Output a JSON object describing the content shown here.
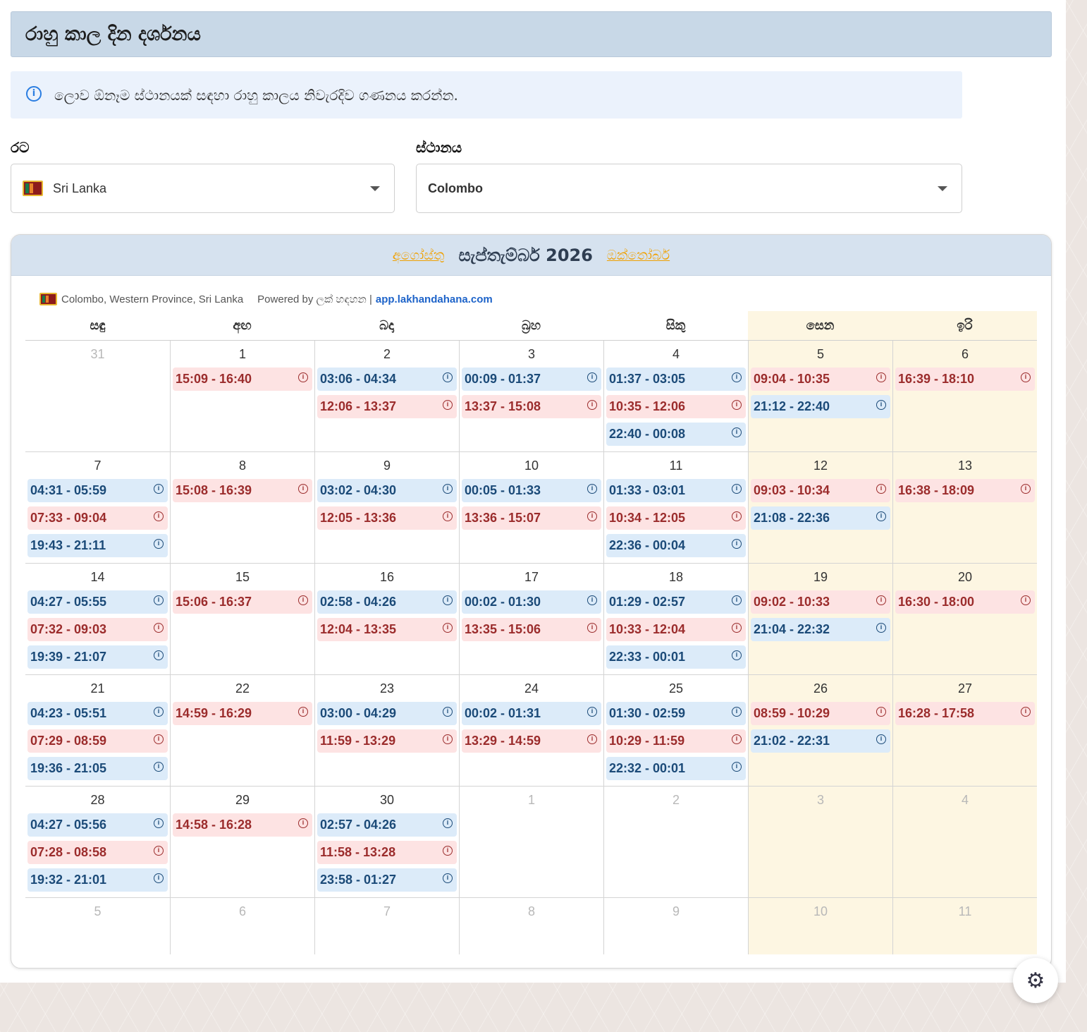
{
  "header": {
    "title": "රාහු කාල දින දර්ශනය"
  },
  "info": {
    "text": "ලොව ඕනෑම ස්ථානයක් සඳහා රාහු කාලය නිවැරදිව ගණනය කරන්න."
  },
  "form": {
    "country_label": "රට",
    "country_value": "Sri Lanka",
    "location_label": "ස්ථානය",
    "location_value": "Colombo"
  },
  "calendar": {
    "prev_month": "අගෝස්තු",
    "current_month": "සැප්තැම්බර් 2026",
    "next_month": "ඔක්තෝබර්",
    "location_line": "Colombo, Western Province, Sri Lanka",
    "powered_by": "Powered by ලක් හඳහන |",
    "site": "app.lakhandahana.com",
    "weekdays": [
      "සඳු",
      "අඟ",
      "බදා",
      "බ්‍රහ",
      "සිකු",
      "සෙන",
      "ඉරි"
    ],
    "weekend_color": "#fdf6e2",
    "red_color": "#9b2c2c",
    "blue_color": "#1b4a78",
    "weeks": [
      [
        {
          "day": "31",
          "muted": true,
          "slots": []
        },
        {
          "day": "1",
          "slots": [
            {
              "t": "15:09 - 16:40",
              "c": "red"
            }
          ]
        },
        {
          "day": "2",
          "slots": [
            {
              "t": "03:06 - 04:34",
              "c": "blue"
            },
            {
              "t": "12:06 - 13:37",
              "c": "red"
            }
          ]
        },
        {
          "day": "3",
          "slots": [
            {
              "t": "00:09 - 01:37",
              "c": "blue"
            },
            {
              "t": "13:37 - 15:08",
              "c": "red"
            }
          ]
        },
        {
          "day": "4",
          "slots": [
            {
              "t": "01:37 - 03:05",
              "c": "blue"
            },
            {
              "t": "10:35 - 12:06",
              "c": "red"
            },
            {
              "t": "22:40 - 00:08",
              "c": "blue"
            }
          ]
        },
        {
          "day": "5",
          "slots": [
            {
              "t": "09:04 - 10:35",
              "c": "red"
            },
            {
              "t": "21:12 - 22:40",
              "c": "blue"
            }
          ]
        },
        {
          "day": "6",
          "slots": [
            {
              "t": "16:39 - 18:10",
              "c": "red"
            }
          ]
        }
      ],
      [
        {
          "day": "7",
          "slots": [
            {
              "t": "04:31 - 05:59",
              "c": "blue"
            },
            {
              "t": "07:33 - 09:04",
              "c": "red"
            },
            {
              "t": "19:43 - 21:11",
              "c": "blue"
            }
          ]
        },
        {
          "day": "8",
          "slots": [
            {
              "t": "15:08 - 16:39",
              "c": "red"
            }
          ]
        },
        {
          "day": "9",
          "slots": [
            {
              "t": "03:02 - 04:30",
              "c": "blue"
            },
            {
              "t": "12:05 - 13:36",
              "c": "red"
            }
          ]
        },
        {
          "day": "10",
          "slots": [
            {
              "t": "00:05 - 01:33",
              "c": "blue"
            },
            {
              "t": "13:36 - 15:07",
              "c": "red"
            }
          ]
        },
        {
          "day": "11",
          "slots": [
            {
              "t": "01:33 - 03:01",
              "c": "blue"
            },
            {
              "t": "10:34 - 12:05",
              "c": "red"
            },
            {
              "t": "22:36 - 00:04",
              "c": "blue"
            }
          ]
        },
        {
          "day": "12",
          "slots": [
            {
              "t": "09:03 - 10:34",
              "c": "red"
            },
            {
              "t": "21:08 - 22:36",
              "c": "blue"
            }
          ]
        },
        {
          "day": "13",
          "slots": [
            {
              "t": "16:38 - 18:09",
              "c": "red"
            }
          ]
        }
      ],
      [
        {
          "day": "14",
          "slots": [
            {
              "t": "04:27 - 05:55",
              "c": "blue"
            },
            {
              "t": "07:32 - 09:03",
              "c": "red"
            },
            {
              "t": "19:39 - 21:07",
              "c": "blue"
            }
          ]
        },
        {
          "day": "15",
          "slots": [
            {
              "t": "15:06 - 16:37",
              "c": "red"
            }
          ]
        },
        {
          "day": "16",
          "slots": [
            {
              "t": "02:58 - 04:26",
              "c": "blue"
            },
            {
              "t": "12:04 - 13:35",
              "c": "red"
            }
          ]
        },
        {
          "day": "17",
          "slots": [
            {
              "t": "00:02 - 01:30",
              "c": "blue"
            },
            {
              "t": "13:35 - 15:06",
              "c": "red"
            }
          ]
        },
        {
          "day": "18",
          "slots": [
            {
              "t": "01:29 - 02:57",
              "c": "blue"
            },
            {
              "t": "10:33 - 12:04",
              "c": "red"
            },
            {
              "t": "22:33 - 00:01",
              "c": "blue"
            }
          ]
        },
        {
          "day": "19",
          "slots": [
            {
              "t": "09:02 - 10:33",
              "c": "red"
            },
            {
              "t": "21:04 - 22:32",
              "c": "blue"
            }
          ]
        },
        {
          "day": "20",
          "slots": [
            {
              "t": "16:30 - 18:00",
              "c": "red"
            }
          ]
        }
      ],
      [
        {
          "day": "21",
          "slots": [
            {
              "t": "04:23 - 05:51",
              "c": "blue"
            },
            {
              "t": "07:29 - 08:59",
              "c": "red"
            },
            {
              "t": "19:36 - 21:05",
              "c": "blue"
            }
          ]
        },
        {
          "day": "22",
          "slots": [
            {
              "t": "14:59 - 16:29",
              "c": "red"
            }
          ]
        },
        {
          "day": "23",
          "slots": [
            {
              "t": "03:00 - 04:29",
              "c": "blue"
            },
            {
              "t": "11:59 - 13:29",
              "c": "red"
            }
          ]
        },
        {
          "day": "24",
          "slots": [
            {
              "t": "00:02 - 01:31",
              "c": "blue"
            },
            {
              "t": "13:29 - 14:59",
              "c": "red"
            }
          ]
        },
        {
          "day": "25",
          "slots": [
            {
              "t": "01:30 - 02:59",
              "c": "blue"
            },
            {
              "t": "10:29 - 11:59",
              "c": "red"
            },
            {
              "t": "22:32 - 00:01",
              "c": "blue"
            }
          ]
        },
        {
          "day": "26",
          "slots": [
            {
              "t": "08:59 - 10:29",
              "c": "red"
            },
            {
              "t": "21:02 - 22:31",
              "c": "blue"
            }
          ]
        },
        {
          "day": "27",
          "slots": [
            {
              "t": "16:28 - 17:58",
              "c": "red"
            }
          ]
        }
      ],
      [
        {
          "day": "28",
          "slots": [
            {
              "t": "04:27 - 05:56",
              "c": "blue"
            },
            {
              "t": "07:28 - 08:58",
              "c": "red"
            },
            {
              "t": "19:32 - 21:01",
              "c": "blue"
            }
          ]
        },
        {
          "day": "29",
          "slots": [
            {
              "t": "14:58 - 16:28",
              "c": "red"
            }
          ]
        },
        {
          "day": "30",
          "slots": [
            {
              "t": "02:57 - 04:26",
              "c": "blue"
            },
            {
              "t": "11:58 - 13:28",
              "c": "red"
            },
            {
              "t": "23:58 - 01:27",
              "c": "blue"
            }
          ]
        },
        {
          "day": "1",
          "muted": true,
          "slots": []
        },
        {
          "day": "2",
          "muted": true,
          "slots": []
        },
        {
          "day": "3",
          "muted": true,
          "slots": []
        },
        {
          "day": "4",
          "muted": true,
          "slots": []
        }
      ],
      [
        {
          "day": "5",
          "muted": true,
          "slots": []
        },
        {
          "day": "6",
          "muted": true,
          "slots": []
        },
        {
          "day": "7",
          "muted": true,
          "slots": []
        },
        {
          "day": "8",
          "muted": true,
          "slots": []
        },
        {
          "day": "9",
          "muted": true,
          "slots": []
        },
        {
          "day": "10",
          "muted": true,
          "slots": []
        },
        {
          "day": "11",
          "muted": true,
          "slots": []
        }
      ]
    ]
  },
  "settings": {
    "icon": "gear-icon"
  }
}
